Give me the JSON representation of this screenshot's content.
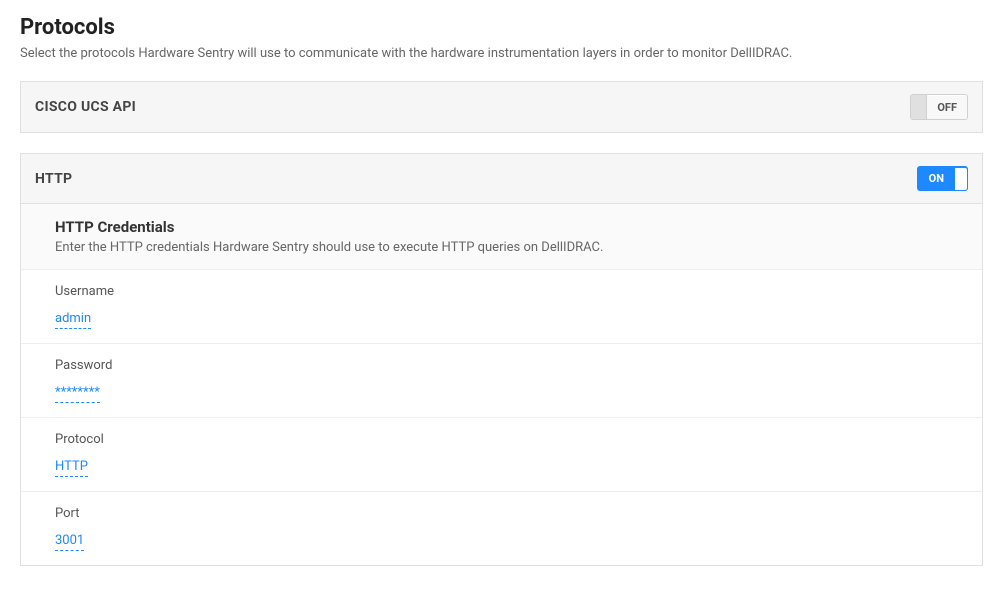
{
  "page": {
    "title": "Protocols",
    "description": "Select the protocols Hardware Sentry will use to communicate with the hardware instrumentation layers in order to monitor DellIDRAC."
  },
  "protocols": {
    "cisco": {
      "title": "CISCO UCS API",
      "toggle_label": "OFF",
      "enabled": false
    },
    "http": {
      "title": "HTTP",
      "toggle_label": "ON",
      "enabled": true,
      "credentials": {
        "title": "HTTP Credentials",
        "description": "Enter the HTTP credentials Hardware Sentry should use to execute HTTP queries on DellIDRAC."
      },
      "fields": {
        "username": {
          "label": "Username",
          "value": "admin"
        },
        "password": {
          "label": "Password",
          "value": "********"
        },
        "protocol": {
          "label": "Protocol",
          "value": "HTTP"
        },
        "port": {
          "label": "Port",
          "value": "3001"
        }
      }
    }
  }
}
